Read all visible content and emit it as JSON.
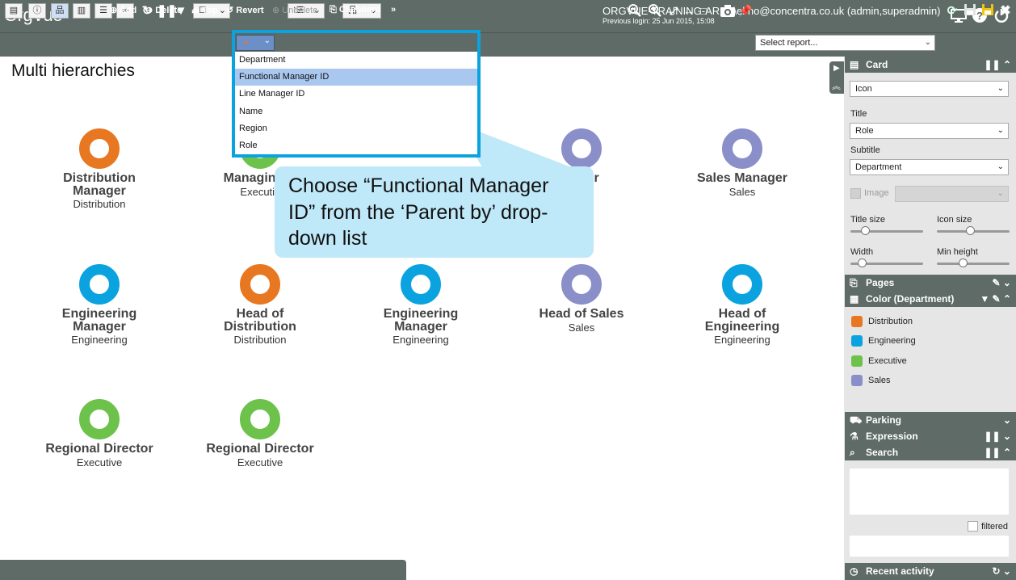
{
  "app": {
    "logo_text": "OrgVue",
    "logo_mark": "®",
    "user_line": "ORGVUE-TRAINING-AREA\\el.no@concentra.co.uk (admin,superadmin)",
    "login_line": "Previous login: 25 Jun 2015, 15:08"
  },
  "toolbar": {
    "select_report_placeholder": "Select report...",
    "chevron": "⌄"
  },
  "dropdown": {
    "items": [
      "Department",
      "Functional Manager ID",
      "Line Manager ID",
      "Name",
      "Region",
      "Role"
    ],
    "selected": "Functional Manager ID"
  },
  "callout": {
    "text": "Choose “Functional Manager ID” from the ‘Parent by’ drop-down list"
  },
  "main": {
    "title": "Multi hierarchies",
    "nodes": [
      {
        "title": "Distribution Manager",
        "subtitle": "Distribution",
        "color": "#e87722"
      },
      {
        "title": "Managing D",
        "subtitle": "Executiv",
        "color": "#6cc24a"
      },
      {
        "title": "nager",
        "subtitle": "s",
        "color": "#8a8fc9"
      },
      {
        "title": "Sales Manager",
        "subtitle": "Sales",
        "color": "#8a8fc9"
      },
      {
        "title": "Engineering Manager",
        "subtitle": "Engineering",
        "color": "#0aa3e0"
      },
      {
        "title": "Head of Distribution",
        "subtitle": "Distribution",
        "color": "#e87722"
      },
      {
        "title": "Engineering Manager",
        "subtitle": "Engineering",
        "color": "#0aa3e0"
      },
      {
        "title": "Head of Sales",
        "subtitle": "Sales",
        "color": "#8a8fc9"
      },
      {
        "title": "Head of Engineering",
        "subtitle": "Engineering",
        "color": "#0aa3e0"
      },
      {
        "title": "Regional Director",
        "subtitle": "Executive",
        "color": "#6cc24a"
      },
      {
        "title": "Regional Director",
        "subtitle": "Executive",
        "color": "#6cc24a"
      }
    ]
  },
  "bottombar": {
    "add": "Add",
    "delete": "Delete",
    "top": "Top",
    "revert": "Revert",
    "undelete": "Undelete",
    "clipboard": "Clipboard",
    "more": "»"
  },
  "panel": {
    "card": {
      "header": "Card",
      "type_value": "Icon",
      "title_label": "Title",
      "title_value": "Role",
      "subtitle_label": "Subtitle",
      "subtitle_value": "Department",
      "image_label": "Image",
      "title_size_label": "Title size",
      "title_size_level": 0.2,
      "icon_size_label": "Icon size",
      "icon_size_level": 0.45,
      "width_label": "Width",
      "width_level": 0.15,
      "min_height_label": "Min height",
      "min_height_level": 0.35
    },
    "pages_header": "Pages",
    "color_header": "Color (Department)",
    "legend": [
      {
        "label": "Distribution",
        "color": "#e87722"
      },
      {
        "label": "Engineering",
        "color": "#0aa3e0"
      },
      {
        "label": "Executive",
        "color": "#6cc24a"
      },
      {
        "label": "Sales",
        "color": "#8a8fc9"
      }
    ],
    "parking_header": "Parking",
    "expression_header": "Expression",
    "search_header": "Search",
    "filtered_label": "filtered",
    "recent_activity_header": "Recent activity"
  }
}
